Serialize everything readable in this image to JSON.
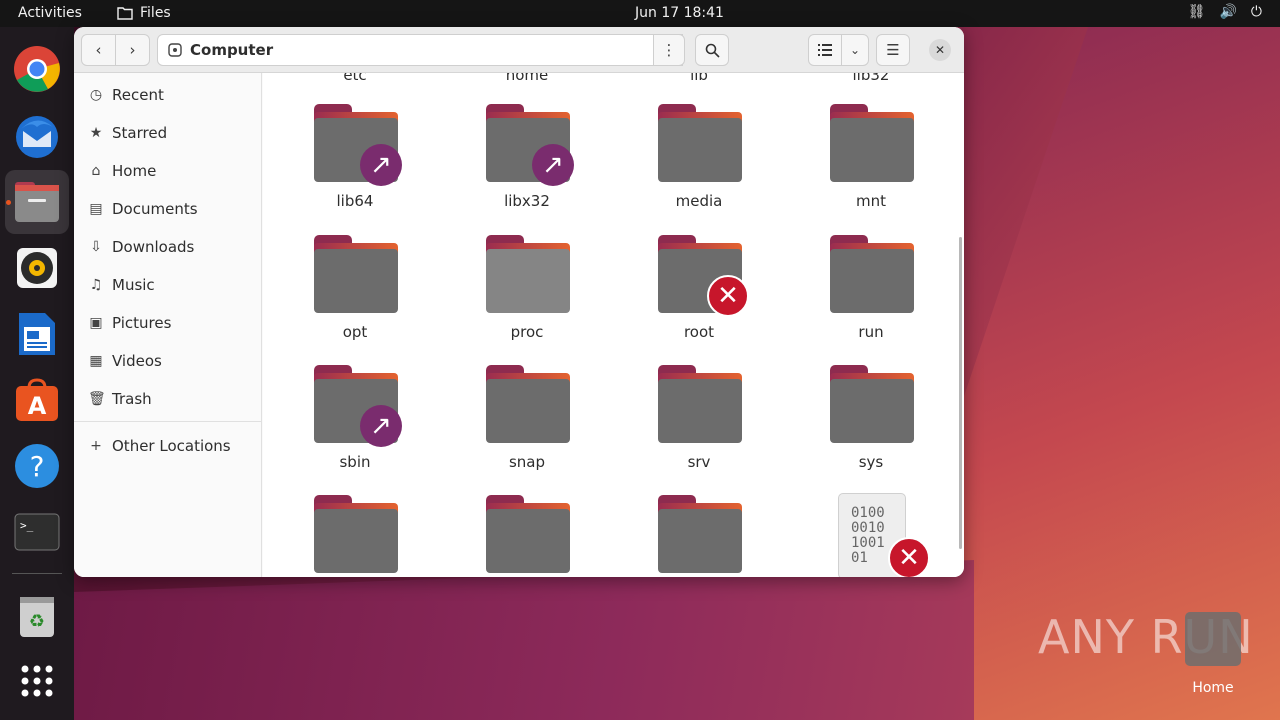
{
  "topbar": {
    "activities": "Activities",
    "app_name": "Files",
    "clock": "Jun 17  18:41"
  },
  "window": {
    "location": "Computer",
    "sidebar": [
      {
        "label": "Recent",
        "icon": "clock-icon"
      },
      {
        "label": "Starred",
        "icon": "star-icon"
      },
      {
        "label": "Home",
        "icon": "home-icon"
      },
      {
        "label": "Documents",
        "icon": "document-icon"
      },
      {
        "label": "Downloads",
        "icon": "download-icon"
      },
      {
        "label": "Music",
        "icon": "music-icon"
      },
      {
        "label": "Pictures",
        "icon": "picture-icon"
      },
      {
        "label": "Videos",
        "icon": "video-icon"
      },
      {
        "label": "Trash",
        "icon": "trash-icon"
      }
    ],
    "other_locations": "Other Locations",
    "partial_row": [
      "etc",
      "home",
      "lib",
      "lib32"
    ],
    "items": [
      {
        "name": "lib64",
        "emblem": "link"
      },
      {
        "name": "libx32",
        "emblem": "link"
      },
      {
        "name": "media",
        "emblem": ""
      },
      {
        "name": "mnt",
        "emblem": ""
      },
      {
        "name": "opt",
        "emblem": ""
      },
      {
        "name": "proc",
        "emblem": ""
      },
      {
        "name": "root",
        "emblem": "no-access"
      },
      {
        "name": "run",
        "emblem": ""
      },
      {
        "name": "sbin",
        "emblem": "link"
      },
      {
        "name": "snap",
        "emblem": ""
      },
      {
        "name": "srv",
        "emblem": ""
      },
      {
        "name": "sys",
        "emblem": ""
      }
    ],
    "binary_file_glyph": "0100\n0010\n1001\n01"
  },
  "desktop": {
    "home_label": "Home",
    "watermark": "ANY RUN"
  }
}
